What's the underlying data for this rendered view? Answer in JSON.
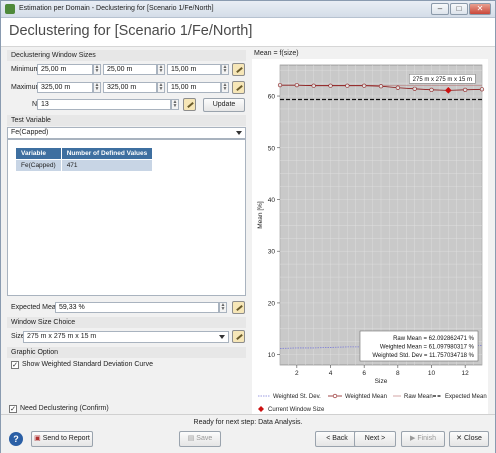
{
  "window": {
    "title": "Estimation per Domain - Declustering for [Scenario 1/Fe/North]"
  },
  "header": {
    "title": "Declustering for [Scenario 1/Fe/North]"
  },
  "declustering": {
    "section_label": "Declustering Window Sizes",
    "min_label": "Minimum",
    "max_label": "Maximum",
    "n_label": "N",
    "min_values": [
      "25,00 m",
      "25,00 m",
      "15,00 m"
    ],
    "max_values": [
      "325,00 m",
      "325,00 m",
      "15,00 m"
    ],
    "n_value": "13",
    "update_label": "Update"
  },
  "test_variable": {
    "section_label": "Test Variable",
    "selected": "Fe(Capped)",
    "columns": [
      "Variable",
      "Number of Defined Values"
    ],
    "rows": [
      [
        "Fe(Capped)",
        "471"
      ]
    ]
  },
  "expected_mean": {
    "label": "Expected Mean",
    "value": "59,33 %"
  },
  "window_size_choice": {
    "section_label": "Window Size Choice",
    "size_label": "Size",
    "selected": "275 m x 275 m x 15 m"
  },
  "graphic_option": {
    "section_label": "Graphic Option",
    "show_weighted_label": "Show Weighted Standard Deviation Curve",
    "show_weighted_checked": true
  },
  "need_declustering": {
    "label": "Need Declustering (Confirm)",
    "checked": true
  },
  "chart_data": {
    "type": "line",
    "title": "Mean = f(size)",
    "xlabel": "Size",
    "ylabel": "Mean [%]",
    "xlim": [
      1,
      13
    ],
    "ylim": [
      8,
      66
    ],
    "xticks": [
      2,
      4,
      6,
      8,
      10,
      12
    ],
    "yticks": [
      10,
      20,
      30,
      40,
      50,
      60
    ],
    "grid": true,
    "x": [
      1,
      2,
      3,
      4,
      5,
      6,
      7,
      8,
      9,
      10,
      11,
      12,
      13
    ],
    "series": [
      {
        "name": "Weighted Mean",
        "color": "#8b1a1a",
        "values": [
          62.1,
          62.1,
          62.0,
          62.0,
          62.0,
          62.0,
          61.9,
          61.6,
          61.4,
          61.2,
          61.1,
          61.2,
          61.3
        ]
      },
      {
        "name": "Weighted St. Dev.",
        "color": "#7b7bd6",
        "values": [
          11.2,
          11.3,
          11.3,
          11.4,
          11.5,
          11.5,
          11.6,
          11.6,
          11.7,
          11.7,
          11.76,
          11.8,
          11.8
        ]
      },
      {
        "name": "Raw Mean",
        "color": "#b56a6a",
        "values": [
          62.09,
          62.09,
          62.09,
          62.09,
          62.09,
          62.09,
          62.09,
          62.09,
          62.09,
          62.09,
          62.09,
          62.09,
          62.09
        ]
      },
      {
        "name": "Expected Mean",
        "color": "#111111",
        "values": [
          59.33,
          59.33,
          59.33,
          59.33,
          59.33,
          59.33,
          59.33,
          59.33,
          59.33,
          59.33,
          59.33,
          59.33,
          59.33
        ]
      }
    ],
    "current_window": {
      "name": "Current Window Size",
      "x": 11,
      "y": 61.1,
      "label": "275 m x 275 m x 15 m",
      "color": "#cc1111"
    },
    "stats_box": [
      "Raw Mean = 62.092862471 %",
      "Weighted Mean = 61.097980317 %",
      "Weighted Std. Dev = 11.757034718 %"
    ],
    "legend_position": "bottom"
  },
  "footer": {
    "status": "Ready for next step: Data Analysis.",
    "send_to_report": "Send to Report",
    "save": "Save",
    "back": "< Back",
    "next": "Next >",
    "finish": "Finish",
    "close": "Close"
  }
}
